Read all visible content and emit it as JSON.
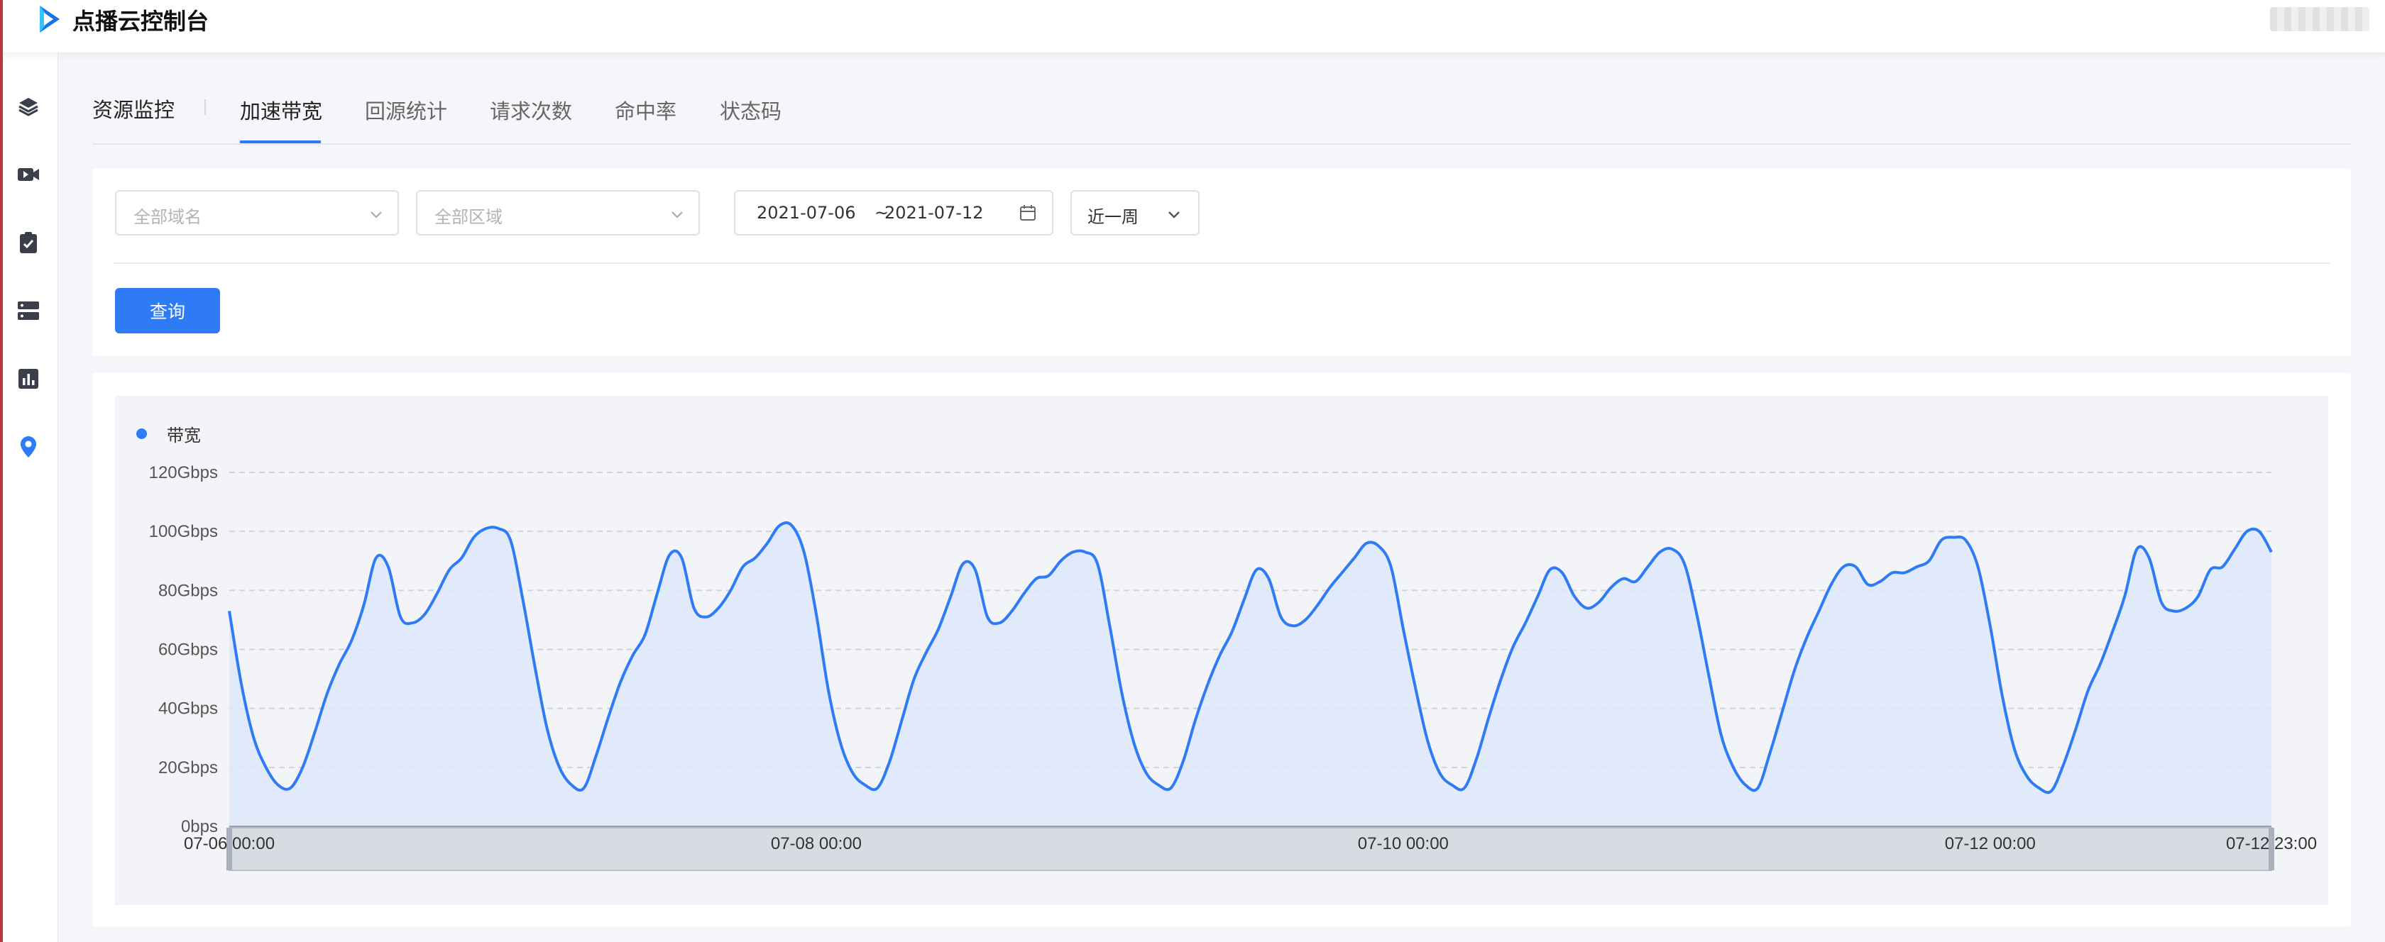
{
  "app": {
    "title": "点播云控制台",
    "accent": "#2f7bf5"
  },
  "sidebar": {
    "items": [
      {
        "icon": "layers-icon"
      },
      {
        "icon": "video-icon"
      },
      {
        "icon": "clipboard-check-icon"
      },
      {
        "icon": "server-icon"
      },
      {
        "icon": "bar-chart-icon"
      },
      {
        "icon": "location-pin-icon",
        "active": true
      }
    ]
  },
  "tabs": {
    "section_title": "资源监控",
    "items": [
      "加速带宽",
      "回源统计",
      "请求次数",
      "命中率",
      "状态码"
    ],
    "active_index": 0
  },
  "filters": {
    "domain_placeholder": "全部域名",
    "region_placeholder": "全部区域",
    "date_start": "2021-07-06",
    "date_sep": "~",
    "date_end": "2021-07-12",
    "range": "近一周",
    "query_button": "查询"
  },
  "chart_data": {
    "type": "area",
    "legend": "带宽",
    "legend_position": "top-left",
    "grid": true,
    "yunit": "Gbps",
    "ylim": [
      0,
      120
    ],
    "y_ticks": [
      "0bps",
      "20Gbps",
      "40Gbps",
      "60Gbps",
      "80Gbps",
      "100Gbps",
      "120Gbps"
    ],
    "x_ticks": [
      "07-06 00:00",
      "07-08 00:00",
      "07-10 00:00",
      "07-12 00:00",
      "07-12 23:00"
    ],
    "x_start": "2021-07-06 00:00",
    "x_end": "2021-07-12 23:00",
    "x_step_hours": 1,
    "series": [
      {
        "name": "带宽",
        "color": "#2f7bf5",
        "values": [
          73,
          48,
          30,
          20,
          14,
          13,
          20,
          32,
          45,
          55,
          63,
          75,
          91,
          88,
          71,
          69,
          72,
          79,
          87,
          91,
          98,
          101,
          101,
          97,
          77,
          54,
          33,
          20,
          14,
          13,
          24,
          37,
          49,
          58,
          65,
          79,
          92,
          91,
          74,
          71,
          74,
          80,
          88,
          91,
          96,
          102,
          102,
          93,
          72,
          46,
          28,
          18,
          14,
          13,
          22,
          36,
          50,
          59,
          67,
          78,
          89,
          87,
          71,
          69,
          73,
          79,
          84,
          85,
          90,
          93,
          93,
          89,
          68,
          45,
          28,
          18,
          14,
          13,
          22,
          36,
          48,
          58,
          66,
          77,
          87,
          84,
          71,
          68,
          70,
          75,
          81,
          86,
          91,
          96,
          95,
          88,
          67,
          47,
          29,
          18,
          14,
          13,
          23,
          37,
          50,
          61,
          69,
          78,
          87,
          86,
          78,
          74,
          76,
          81,
          84,
          83,
          88,
          93,
          94,
          89,
          72,
          51,
          31,
          20,
          14,
          13,
          25,
          39,
          53,
          64,
          73,
          82,
          88,
          88,
          82,
          83,
          86,
          86,
          88,
          90,
          97,
          98,
          97,
          88,
          68,
          44,
          26,
          17,
          13,
          12,
          21,
          33,
          46,
          55,
          66,
          78,
          94,
          91,
          76,
          73,
          74,
          78,
          87,
          88,
          94,
          100,
          100,
          93
        ]
      }
    ]
  }
}
